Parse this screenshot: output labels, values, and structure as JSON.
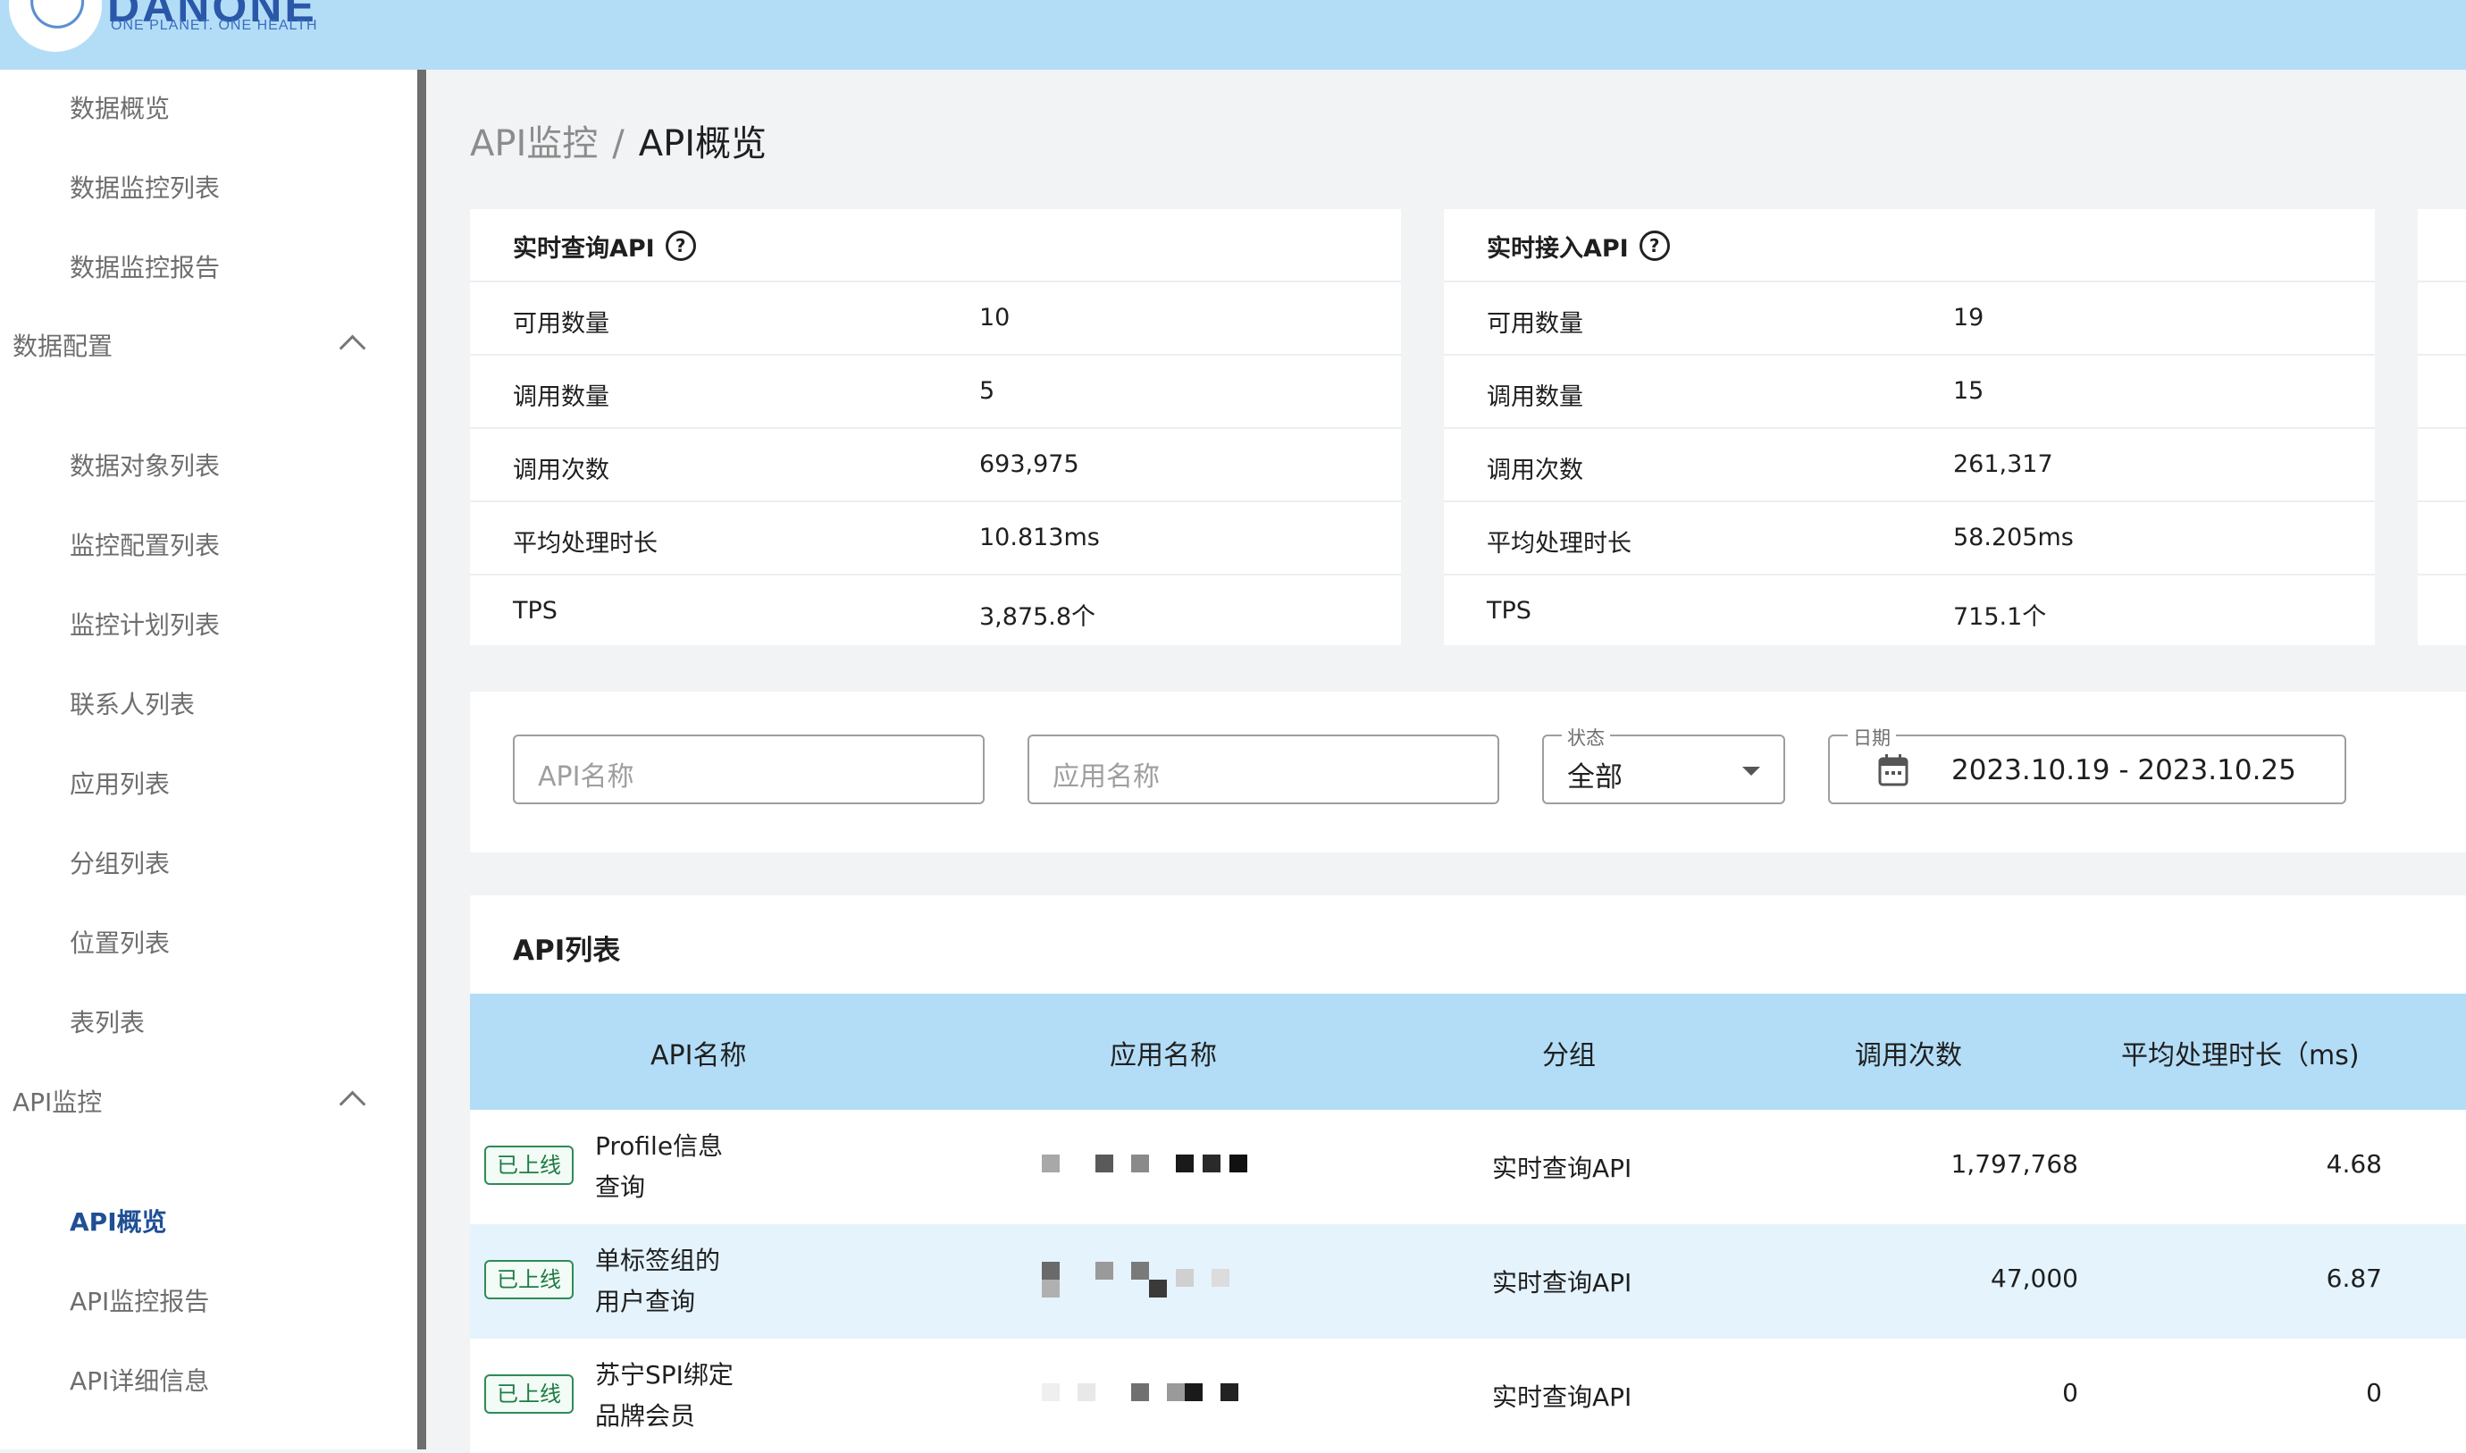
{
  "header": {
    "brand": "DANONE",
    "tagline": "ONE PLANET. ONE HEALTH"
  },
  "sidebar": {
    "items_top": [
      {
        "label": "数据概览"
      },
      {
        "label": "数据监控列表"
      },
      {
        "label": "数据监控报告"
      }
    ],
    "group_data_config": {
      "label": "数据配置"
    },
    "items_config": [
      {
        "label": "数据对象列表"
      },
      {
        "label": "监控配置列表"
      },
      {
        "label": "监控计划列表"
      },
      {
        "label": "联系人列表"
      },
      {
        "label": "应用列表"
      },
      {
        "label": "分组列表"
      },
      {
        "label": "位置列表"
      },
      {
        "label": "表列表"
      }
    ],
    "group_api_monitor": {
      "label": "API监控"
    },
    "items_api": [
      {
        "label": "API概览",
        "active": true
      },
      {
        "label": "API监控报告"
      },
      {
        "label": "API详细信息"
      }
    ]
  },
  "breadcrumb": {
    "parent": "API监控",
    "separator": "/",
    "current": "API概览"
  },
  "cards": [
    {
      "title": "实时查询API",
      "rows": [
        {
          "label": "可用数量",
          "value": "10"
        },
        {
          "label": "调用数量",
          "value": "5"
        },
        {
          "label": "调用次数",
          "value": "693,975"
        },
        {
          "label": "平均处理时长",
          "value": "10.813ms"
        },
        {
          "label": "TPS",
          "value": "3,875.8个"
        }
      ]
    },
    {
      "title": "实时接入API",
      "rows": [
        {
          "label": "可用数量",
          "value": "19"
        },
        {
          "label": "调用数量",
          "value": "15"
        },
        {
          "label": "调用次数",
          "value": "261,317"
        },
        {
          "label": "平均处理时长",
          "value": "58.205ms"
        },
        {
          "label": "TPS",
          "value": "715.1个"
        }
      ]
    }
  ],
  "filters": {
    "api_name_placeholder": "API名称",
    "app_name_placeholder": "应用名称",
    "status_label": "状态",
    "status_value": "全部",
    "date_label": "日期",
    "date_value": "2023.10.19 - 2023.10.25"
  },
  "table": {
    "title": "API列表",
    "columns": [
      "API名称",
      "应用名称",
      "分组",
      "调用次数",
      "平均处理时长（ms)"
    ],
    "rows": [
      {
        "status": "已上线",
        "api_name_1": "Profile信息",
        "api_name_2": "查询",
        "app_name": "",
        "group": "实时查询API",
        "calls": "1,797,768",
        "avg_ms": "4.68"
      },
      {
        "status": "已上线",
        "api_name_1": "单标签组的",
        "api_name_2": "用户查询",
        "app_name": "",
        "group": "实时查询API",
        "calls": "47,000",
        "avg_ms": "6.87"
      },
      {
        "status": "已上线",
        "api_name_1": "苏宁SPI绑定",
        "api_name_2": "品牌会员",
        "app_name": "",
        "group": "实时查询API",
        "calls": "0",
        "avg_ms": "0"
      }
    ]
  },
  "colors": {
    "header_bg": "#b3ddf7",
    "active_nav": "#1f4f94",
    "badge_green": "#2e8b57",
    "row_highlight": "#e5f3fc"
  }
}
